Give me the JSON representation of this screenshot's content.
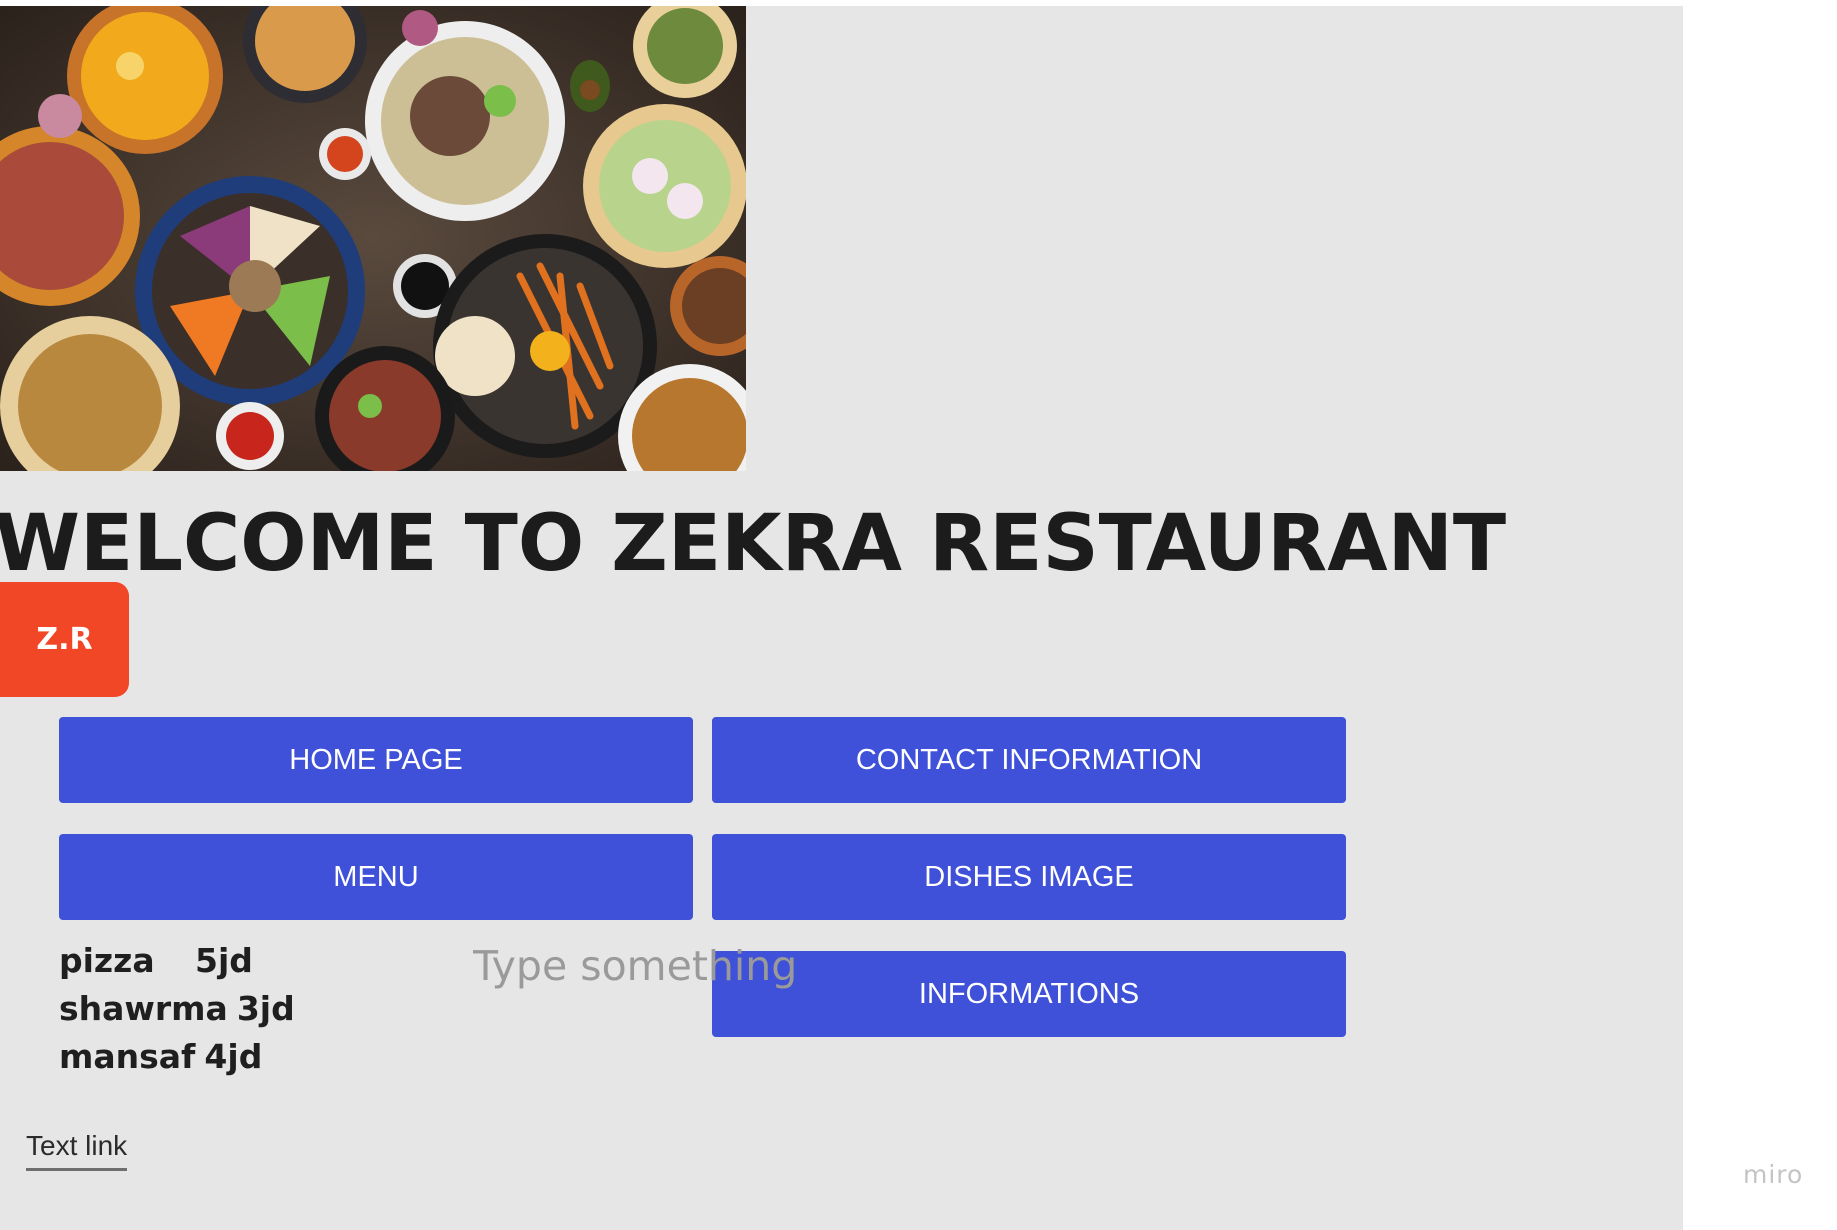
{
  "hero": {
    "image_name": "food-spread-photo"
  },
  "heading": {
    "title": "WELCOME TO ZEKRA RESTAURANT"
  },
  "logo": {
    "text": "Z.R",
    "color": "#f24726"
  },
  "nav": {
    "button_color": "#3f51d9",
    "home": "HOME PAGE",
    "contact": "CONTACT INFORMATION",
    "menu": "MENU",
    "dishes": "DISHES IMAGE",
    "informations": "INFORMATIONS"
  },
  "menu_list": [
    {
      "dish": "pizza",
      "price": "5jd"
    },
    {
      "dish": "shawrma",
      "price": "3jd"
    },
    {
      "dish": "mansaf",
      "price": "4jd"
    }
  ],
  "text_input": {
    "placeholder": "Type something"
  },
  "footer": {
    "link": "Text link"
  },
  "watermark": "miro",
  "colors": {
    "canvas": "#e6e6e6",
    "page": "#ffffff"
  }
}
